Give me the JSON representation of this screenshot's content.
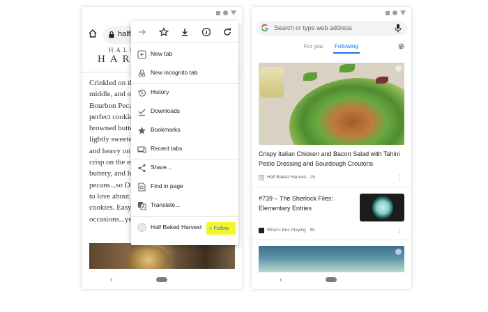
{
  "left_phone": {
    "url_text": "halfba",
    "site_logo": {
      "line1": "HALF",
      "line2": "HAR"
    },
    "article_lines": [
      "Crinkled on th",
      "middle, and oh",
      "Bourbon Peca",
      "perfect cookie",
      "browned butte",
      "lightly sweete",
      "and heavy on t",
      "crisp on the ed",
      "buttery, and le",
      "pecans...so DE",
      "to love about th",
      "cookies. Easy t",
      "occasions...yet"
    ],
    "menu": {
      "top_icons": [
        "forward-icon",
        "star-icon",
        "download-icon",
        "info-icon",
        "refresh-icon"
      ],
      "items": [
        {
          "label": "New tab",
          "icon": "plus-square-icon"
        },
        {
          "label": "New incognito tab",
          "icon": "incognito-icon"
        },
        {
          "label": "History",
          "icon": "history-icon"
        },
        {
          "label": "Downloads",
          "icon": "download-check-icon"
        },
        {
          "label": "Bookmarks",
          "icon": "star-icon"
        },
        {
          "label": "Recent tabs",
          "icon": "devices-icon"
        },
        {
          "label": "Share...",
          "icon": "share-icon"
        },
        {
          "label": "Find in page",
          "icon": "find-in-page-icon"
        },
        {
          "label": "Translate...",
          "icon": "translate-icon"
        }
      ],
      "site_row": {
        "label": "Half Baked Harvest",
        "follow_label": "+ Follow",
        "highlight_color": "#f3f62a"
      }
    },
    "nav_back": "‹"
  },
  "right_phone": {
    "search_placeholder": "Search or type web address",
    "tabs": [
      {
        "label": "For you",
        "active": false
      },
      {
        "label": "Following",
        "active": true
      }
    ],
    "cards": [
      {
        "title": "Crispy Italian Chicken and Bacon Salad with Tahini Pesto Dressing and Sourdough Croutons",
        "meta": "Half Baked Harvest · 2h"
      },
      {
        "title": "#739 – The Sherlock Files: Elementary Entries",
        "meta": "What's Eric Playing · 5h"
      }
    ],
    "nav_back": "‹"
  },
  "colors": {
    "accent": "#1a73e8",
    "follow_highlight": "#f3f62a"
  }
}
